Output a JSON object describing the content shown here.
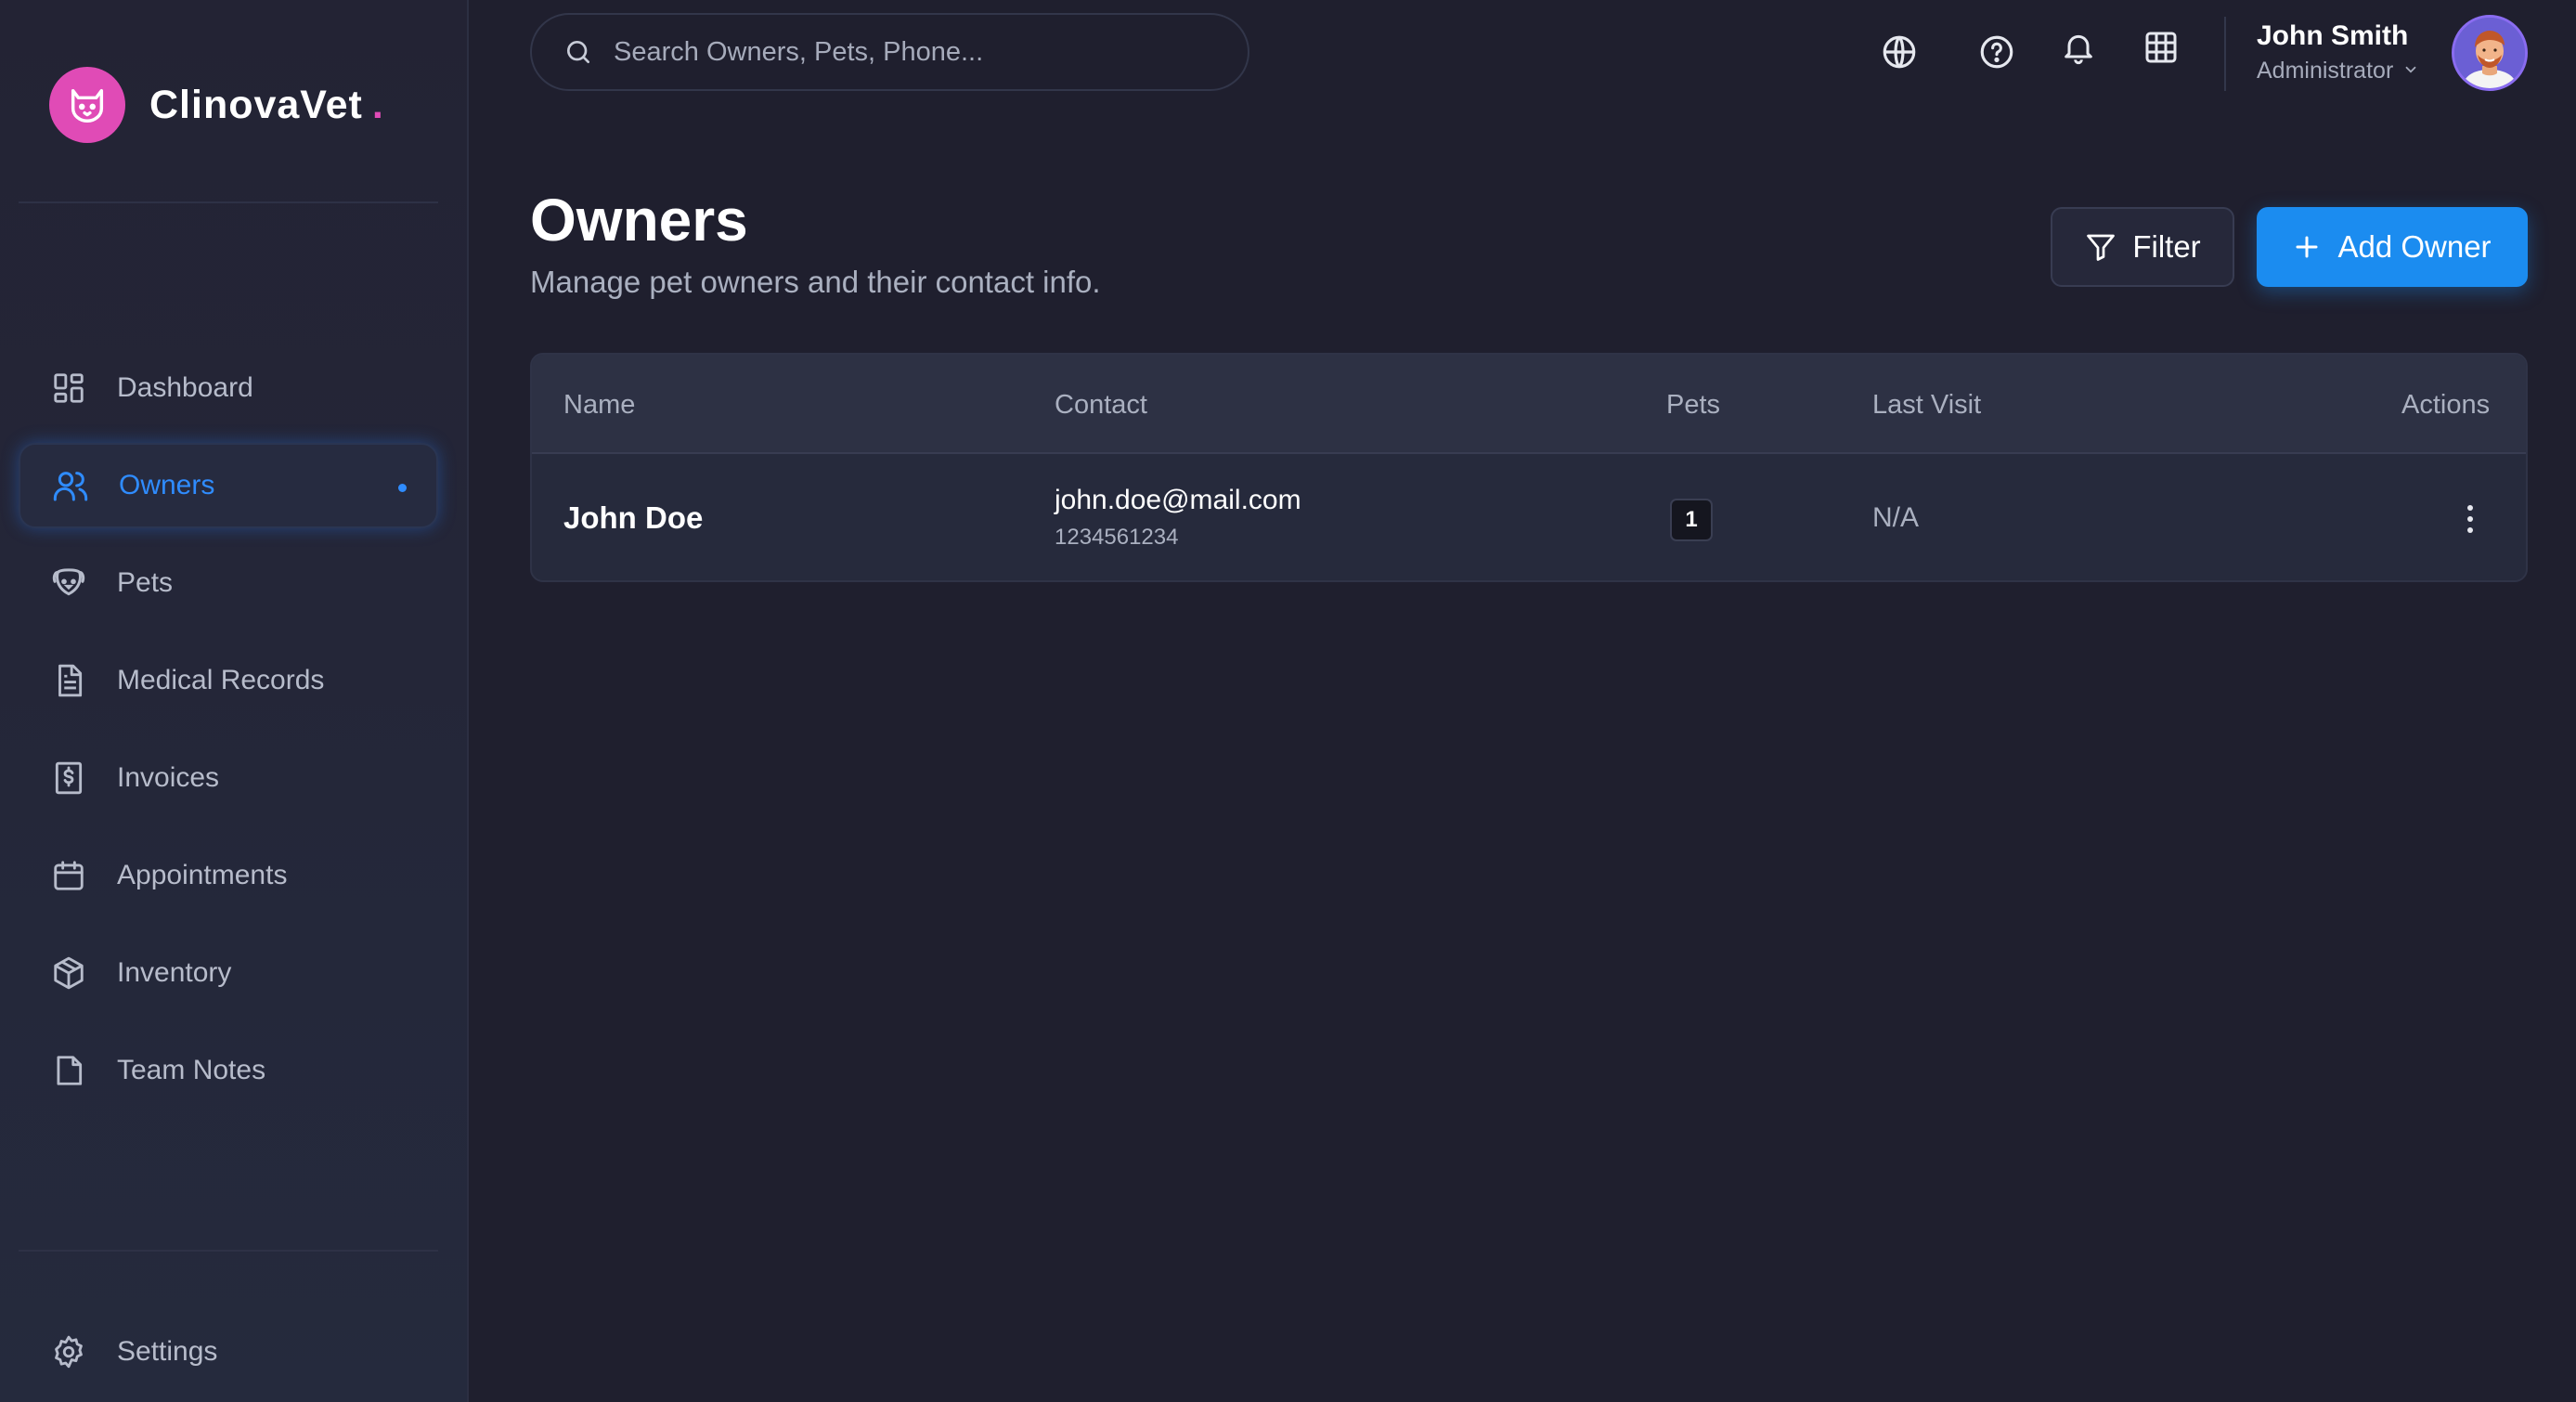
{
  "brand": {
    "name": "ClinovaVet",
    "dot": ".",
    "logo_icon": "cat-icon",
    "accent": "#e04bb6"
  },
  "sidebar": {
    "items": [
      {
        "label": "Dashboard",
        "icon": "dashboard-icon"
      },
      {
        "label": "Owners",
        "icon": "users-icon",
        "active": true
      },
      {
        "label": "Pets",
        "icon": "paw-icon"
      },
      {
        "label": "Medical Records",
        "icon": "document-icon"
      },
      {
        "label": "Invoices",
        "icon": "invoice-icon"
      },
      {
        "label": "Appointments",
        "icon": "calendar-icon"
      },
      {
        "label": "Inventory",
        "icon": "box-icon"
      },
      {
        "label": "Team Notes",
        "icon": "note-icon"
      }
    ],
    "settings_label": "Settings"
  },
  "header": {
    "search_placeholder": "Search Owners, Pets, Phone...",
    "icons": [
      "globe-icon",
      "help-icon",
      "bell-icon",
      "grid-icon"
    ],
    "user": {
      "name": "John Smith",
      "role": "Administrator"
    }
  },
  "main": {
    "title": "Owners",
    "subtitle": "Manage pet owners and their contact info.",
    "filter_label": "Filter",
    "add_label": "Add Owner",
    "primary_color": "#1b8cf0"
  },
  "table": {
    "columns": [
      "Name",
      "Contact",
      "Pets",
      "Last Visit",
      "Actions"
    ],
    "rows": [
      {
        "name": "John Doe",
        "email": "john.doe@mail.com",
        "phone": "1234561234",
        "pets": "1",
        "last_visit": "N/A"
      }
    ]
  }
}
